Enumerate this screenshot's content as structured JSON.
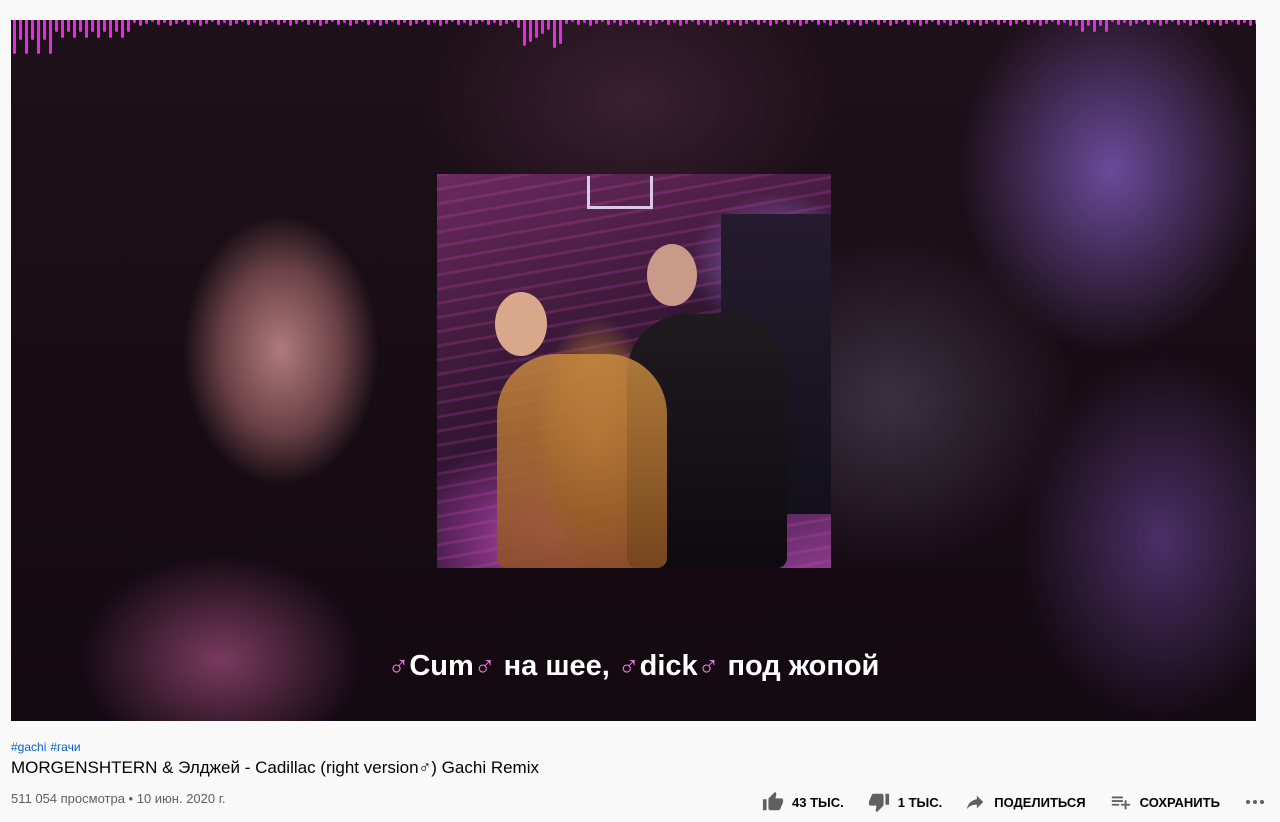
{
  "video": {
    "lyric_sym_1": "♂",
    "lyric_word_1": "Cum",
    "lyric_sym_2": "♂",
    "lyric_mid": " на шее, ",
    "lyric_sym_3": "♂",
    "lyric_word_2": "dick",
    "lyric_sym_4": "♂",
    "lyric_end": " под жопой",
    "accent_color": "#e02ee0",
    "lyric_symbol_color": "#f07ae0"
  },
  "hashtags": [
    "#gachi",
    "#гачи"
  ],
  "title": "MORGENSHTERN & Элджей - Cadillac (right version♂) Gachi Remix",
  "meta": {
    "views": "511 054 просмотра",
    "separator": " • ",
    "date": "10 июн. 2020 г."
  },
  "actions": {
    "like_label": "43 ТЫС.",
    "dislike_label": "1 ТЫС.",
    "share_label": "ПОДЕЛИТЬСЯ",
    "save_label": "СОХРАНИТЬ",
    "icons": {
      "like": "thumb-up-icon",
      "dislike": "thumb-down-icon",
      "share": "share-arrow-icon",
      "save": "playlist-add-icon",
      "more": "more-horiz-icon"
    }
  }
}
